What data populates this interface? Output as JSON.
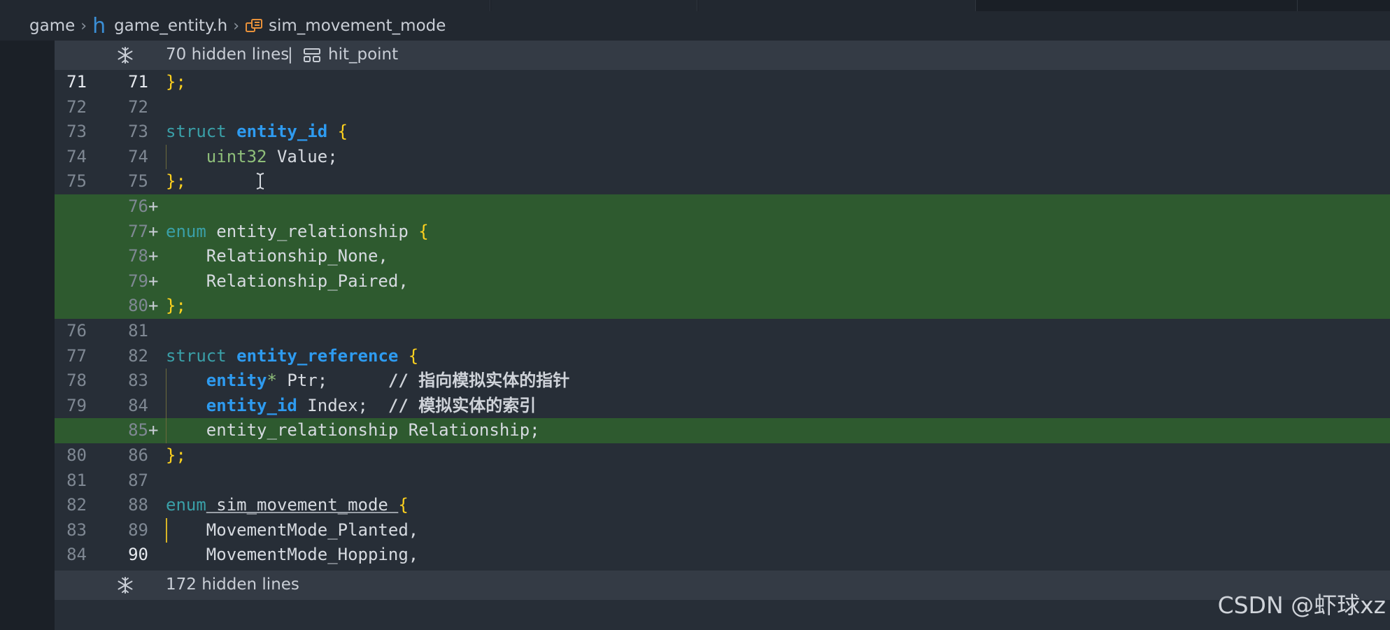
{
  "breadcrumb": {
    "root": "game",
    "file": "game_entity.h",
    "file_icon": "h",
    "symbol": "sim_movement_mode"
  },
  "folds": {
    "top": {
      "text": "70 hidden lines",
      "separator": "|",
      "scope": "hit_point"
    },
    "bottom": {
      "text": "172 hidden lines"
    }
  },
  "lines": [
    {
      "old": "71",
      "new": "71",
      "added": false,
      "active": true
    },
    {
      "old": "72",
      "new": "72",
      "added": false
    },
    {
      "old": "73",
      "new": "73",
      "added": false
    },
    {
      "old": "74",
      "new": "74",
      "added": false
    },
    {
      "old": "75",
      "new": "75",
      "added": false
    },
    {
      "old": "",
      "new": "76",
      "added": true,
      "marker": "+"
    },
    {
      "old": "",
      "new": "77",
      "added": true,
      "marker": "+"
    },
    {
      "old": "",
      "new": "78",
      "added": true,
      "marker": "+"
    },
    {
      "old": "",
      "new": "79",
      "added": true,
      "marker": "+"
    },
    {
      "old": "",
      "new": "80",
      "added": true,
      "marker": "+"
    },
    {
      "old": "76",
      "new": "81",
      "added": false
    },
    {
      "old": "77",
      "new": "82",
      "added": false
    },
    {
      "old": "78",
      "new": "83",
      "added": false
    },
    {
      "old": "79",
      "new": "84",
      "added": false
    },
    {
      "old": "",
      "new": "85",
      "added": true,
      "marker": "+"
    },
    {
      "old": "80",
      "new": "86",
      "added": false
    },
    {
      "old": "81",
      "new": "87",
      "added": false
    },
    {
      "old": "82",
      "new": "88",
      "added": false
    },
    {
      "old": "83",
      "new": "89",
      "added": false
    },
    {
      "old": "84",
      "new": "90",
      "added": false,
      "active_new": true
    }
  ],
  "code": {
    "l71": "};",
    "l73_kw": "struct",
    "l73_name": "entity_id",
    "l73_brace": "{",
    "l74_type": "uint32",
    "l74_rest": " Value;",
    "l75": "};",
    "l77_kw": "enum",
    "l77_name": " entity_relationship ",
    "l77_brace": "{",
    "l78": "Relationship_None,",
    "l79": "Relationship_Paired,",
    "l80": "};",
    "l82_kw": "struct",
    "l82_name": "entity_reference",
    "l82_brace": "{",
    "l83_type": "entity",
    "l83_star": "*",
    "l83_rest": " Ptr;      ",
    "l83_cmt": "// 指向模拟实体的指针",
    "l84_type": "entity_id",
    "l84_rest": " Index;  ",
    "l84_cmt": "// 模拟实体的索引",
    "l85": "entity_relationship Relationship;",
    "l86": "};",
    "l88_kw": "enum",
    "l88_name": " sim_movement_mode ",
    "l88_brace": "{",
    "l89": "MovementMode_Planted,",
    "l90": "MovementMode_Hopping,"
  },
  "watermark": "CSDN @虾球xz",
  "icons": {
    "fold": "unfold-snowflake-icon",
    "file": "header-file-icon",
    "symbol": "enum-symbol-icon",
    "struct": "struct-symbol-icon",
    "cursor": "text-cursor-icon"
  },
  "colors": {
    "added_bg": "#2e5a2f",
    "keyword": "#3aa0a8",
    "type": "#2e9bf0",
    "brace": "#ffd21e",
    "editor_bg": "#272e37"
  }
}
